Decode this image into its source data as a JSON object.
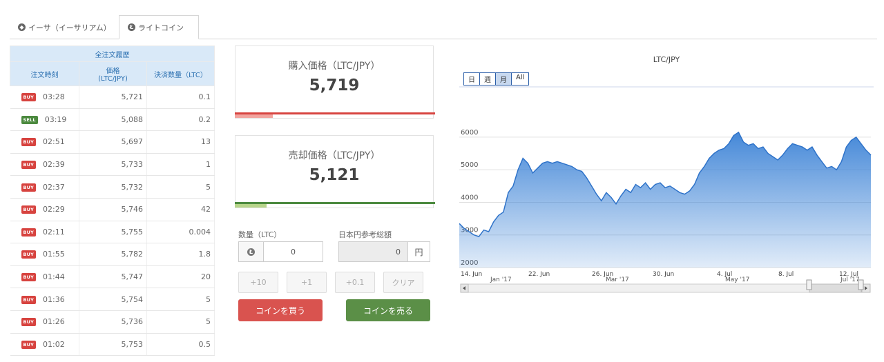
{
  "tabs": [
    {
      "label": "イーサ（イーサリアム）",
      "icon": "ethereum-icon"
    },
    {
      "label": "ライトコイン",
      "icon": "litecoin-icon"
    }
  ],
  "history": {
    "caption": "全注文履歴",
    "headers": {
      "time": "注文時刻",
      "price_line1": "価格",
      "price_line2": "(LTC/JPY)",
      "qty": "決済数量（LTC）"
    },
    "rows": [
      {
        "type": "BUY",
        "time": "03:28",
        "price": "5,721",
        "qty": "0.1"
      },
      {
        "type": "SELL",
        "time": "03:19",
        "price": "5,088",
        "qty": "0.2"
      },
      {
        "type": "BUY",
        "time": "02:51",
        "price": "5,697",
        "qty": "13"
      },
      {
        "type": "BUY",
        "time": "02:39",
        "price": "5,733",
        "qty": "1"
      },
      {
        "type": "BUY",
        "time": "02:37",
        "price": "5,732",
        "qty": "5"
      },
      {
        "type": "BUY",
        "time": "02:29",
        "price": "5,746",
        "qty": "42"
      },
      {
        "type": "BUY",
        "time": "02:11",
        "price": "5,755",
        "qty": "0.004"
      },
      {
        "type": "BUY",
        "time": "01:55",
        "price": "5,782",
        "qty": "1.8"
      },
      {
        "type": "BUY",
        "time": "01:44",
        "price": "5,747",
        "qty": "20"
      },
      {
        "type": "BUY",
        "time": "01:36",
        "price": "5,754",
        "qty": "5"
      },
      {
        "type": "BUY",
        "time": "01:26",
        "price": "5,736",
        "qty": "5"
      },
      {
        "type": "BUY",
        "time": "01:02",
        "price": "5,753",
        "qty": "0.5"
      }
    ]
  },
  "buy_box": {
    "label": "購入価格（LTC/JPY）",
    "value": "5,719",
    "indicator_fraction": 0.19
  },
  "sell_box": {
    "label": "売却価格（LTC/JPY）",
    "value": "5,121",
    "indicator_fraction": 0.16
  },
  "form": {
    "qty_label": "数量（LTC）",
    "qty_value": "0",
    "yen_label": "日本円参考総額",
    "yen_value": "0",
    "yen_unit": "円",
    "quick_buttons": [
      "+10",
      "+1",
      "+0.1",
      "クリア"
    ],
    "buy_button": "コインを買う",
    "sell_button": "コインを売る"
  },
  "chart_data": {
    "type": "area",
    "title": "LTC/JPY",
    "range_buttons": [
      {
        "label": "日",
        "active": false
      },
      {
        "label": "週",
        "active": false
      },
      {
        "label": "月",
        "active": true
      },
      {
        "label": "All",
        "active": false
      }
    ],
    "ylim": [
      2000,
      6400
    ],
    "yticks": [
      2000,
      3000,
      4000,
      5000,
      6000
    ],
    "xticks": [
      "14. Jun",
      "22. Jun",
      "26. Jun",
      "30. Jun",
      "4. Jul",
      "8. Jul",
      "12. Jul"
    ],
    "navigator_labels": [
      "Jan '17",
      "Mar '17",
      "May '17",
      "Jul '17"
    ],
    "color": "#3b82d6",
    "values": [
      3350,
      3200,
      3100,
      3000,
      2950,
      3150,
      3100,
      3400,
      3600,
      3700,
      4300,
      4500,
      5000,
      5350,
      5200,
      4900,
      5050,
      5200,
      5250,
      5200,
      5250,
      5200,
      5150,
      5100,
      5000,
      4950,
      4750,
      4500,
      4250,
      4050,
      4300,
      4150,
      3950,
      4200,
      4400,
      4300,
      4550,
      4450,
      4600,
      4400,
      4550,
      4600,
      4450,
      4500,
      4400,
      4300,
      4250,
      4350,
      4550,
      4900,
      5100,
      5350,
      5500,
      5600,
      5650,
      5800,
      6050,
      6150,
      5850,
      5750,
      5800,
      5650,
      5700,
      5500,
      5400,
      5300,
      5450,
      5650,
      5800,
      5750,
      5700,
      5600,
      5700,
      5450,
      5250,
      5050,
      5100,
      5000,
      5250,
      5700,
      5900,
      6000,
      5800,
      5600,
      5450
    ]
  }
}
